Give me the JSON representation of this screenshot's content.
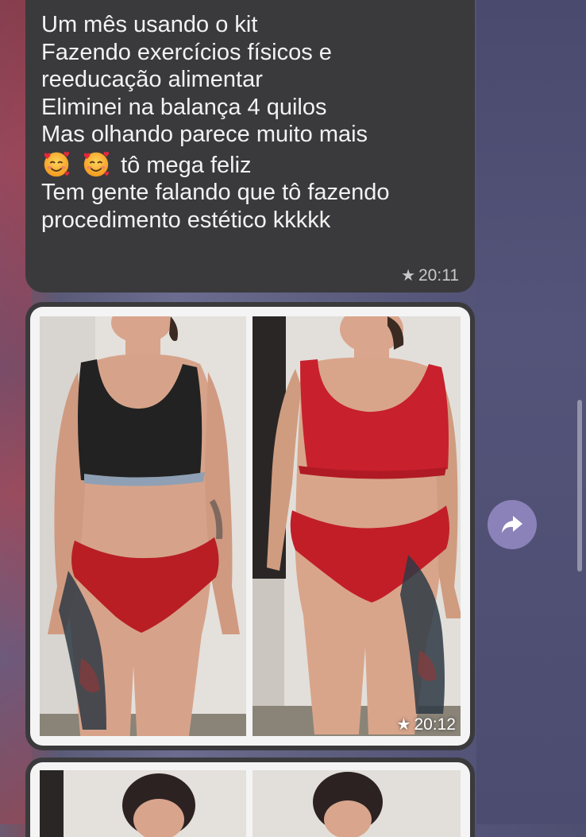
{
  "messages": [
    {
      "type": "text",
      "lines": [
        "Um mês usando o kit",
        "Fazendo exercícios físicos e",
        "reeducação alimentar",
        "Eliminei na balança 4 quilos",
        "Mas olhando parece muito mais",
        "tô mega feliz",
        "Tem gente falando que tô fazendo",
        "procedimento estético kkkkk"
      ],
      "emoji": "smiling-face-with-hearts-icon",
      "starred": true,
      "time": "20:11"
    },
    {
      "type": "photo",
      "photos": [
        "before-photo",
        "after-photo"
      ],
      "starred": true,
      "time": "20:12"
    },
    {
      "type": "photo",
      "photos": [
        "before-photo",
        "after-photo"
      ],
      "partial": true
    }
  ],
  "forward_icon": "forward-arrow-icon",
  "colors": {
    "bubble": "#3a3a3c",
    "text": "#f2f2f2",
    "meta": "#c8c8cc",
    "forward_button": "#8a82b8"
  }
}
